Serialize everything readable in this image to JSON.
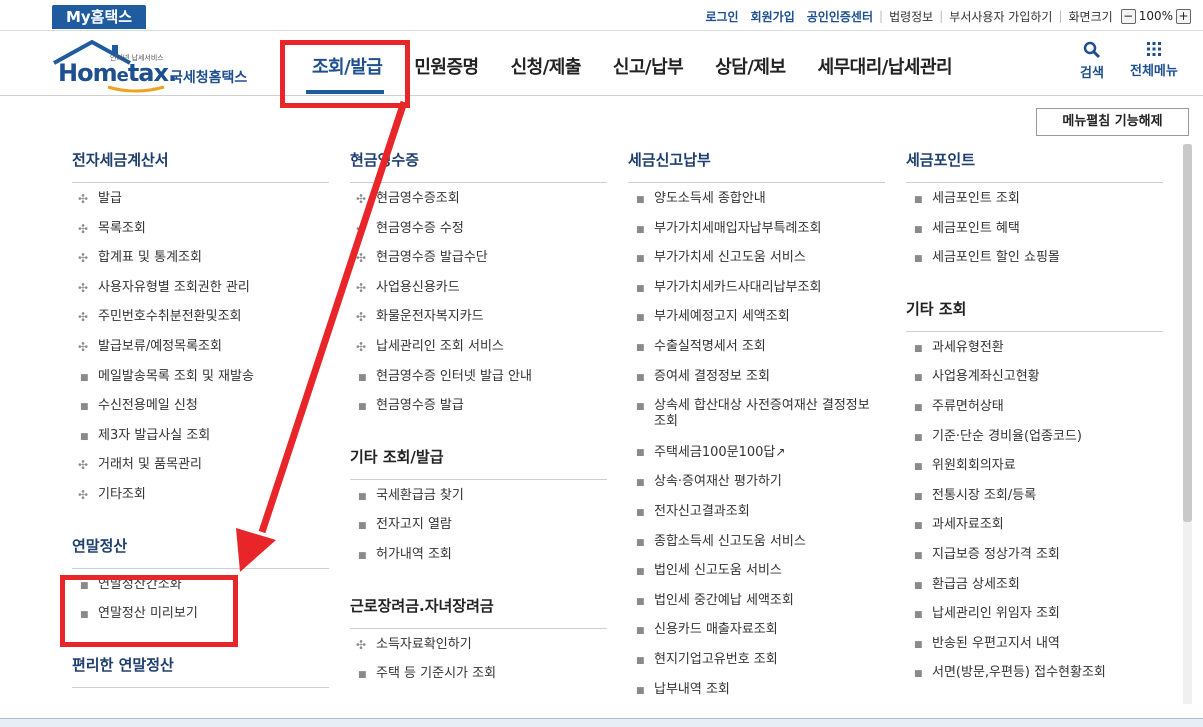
{
  "colors": {
    "brand": "#1e5b9f",
    "title": "#1e3e6e",
    "annotation": "#e8262a"
  },
  "utilbar": {
    "my_tab": "My홈택스",
    "links": [
      "로그인",
      "회원가입",
      "공인인증센터",
      "법령정보",
      "부서사용자 가입하기",
      "화면크기"
    ],
    "zoom_minus": "−",
    "zoom_value": "100%",
    "zoom_plus": "+"
  },
  "header": {
    "logo_main": "Hom",
    "logo_e": "e",
    "logo_end": "tax.",
    "logo_sub": "국세청홈택스",
    "logo_tiny": "인터넷 납세서비스",
    "menus": [
      "조회/발급",
      "민원증명",
      "신청/제출",
      "신고/납부",
      "상담/제보",
      "세무대리/납세관리"
    ],
    "search_label": "검색",
    "allmenu_label": "전체메뉴",
    "fold_button": "메뉴펼침 기능해제"
  },
  "columns": [
    {
      "sections": [
        {
          "title": "전자세금계산서",
          "style": "blue",
          "items": [
            {
              "b": "plus",
              "t": "발급"
            },
            {
              "b": "plus",
              "t": "목록조회"
            },
            {
              "b": "plus",
              "t": "합계표 및 통계조회"
            },
            {
              "b": "plus",
              "t": "사용자유형별 조회권한 관리"
            },
            {
              "b": "plus",
              "t": "주민번호수취분전환및조회"
            },
            {
              "b": "plus",
              "t": "발급보류/예정목록조회"
            },
            {
              "b": "dot",
              "t": "메일발송목록 조회 및 재발송"
            },
            {
              "b": "dot",
              "t": "수신전용메일 신청"
            },
            {
              "b": "dot",
              "t": "제3자 발급사실 조회"
            },
            {
              "b": "plus",
              "t": "거래처 및 품목관리"
            },
            {
              "b": "plus",
              "t": "기타조회"
            }
          ]
        },
        {
          "title": "연말정산",
          "style": "blue",
          "items": [
            {
              "b": "dot",
              "t": "연말정산간소화"
            },
            {
              "b": "dot",
              "t": "연말정산 미리보기"
            }
          ]
        },
        {
          "title": "편리한 연말정산",
          "style": "blue",
          "items": []
        }
      ]
    },
    {
      "sections": [
        {
          "title": "현금영수증",
          "style": "blue",
          "items": [
            {
              "b": "plus",
              "t": "현금영수증조회"
            },
            {
              "b": "plus",
              "t": "현금영수증 수정"
            },
            {
              "b": "plus",
              "t": "현금영수증 발급수단"
            },
            {
              "b": "plus",
              "t": "사업용신용카드"
            },
            {
              "b": "plus",
              "t": "화물운전자복지카드"
            },
            {
              "b": "plus",
              "t": "납세관리인 조회 서비스"
            },
            {
              "b": "dot",
              "t": "현금영수증 인터넷 발급 안내"
            },
            {
              "b": "dot",
              "t": "현금영수증 발급"
            }
          ]
        },
        {
          "title": "기타 조회/발급",
          "style": "plain",
          "items": [
            {
              "b": "dot",
              "t": "국세환급금 찾기"
            },
            {
              "b": "dot",
              "t": "전자고지 열람"
            },
            {
              "b": "dot",
              "t": "허가내역 조회"
            }
          ]
        },
        {
          "title": "근로장려금.자녀장려금",
          "style": "plain",
          "items": [
            {
              "b": "plus",
              "t": "소득자료확인하기"
            },
            {
              "b": "dot",
              "t": "주택 등 기준시가 조회"
            }
          ]
        }
      ]
    },
    {
      "sections": [
        {
          "title": "세금신고납부",
          "style": "blue",
          "items": [
            {
              "b": "dot",
              "t": "양도소득세 종합안내"
            },
            {
              "b": "dot",
              "t": "부가가치세매입자납부특례조회"
            },
            {
              "b": "dot",
              "t": "부가가치세 신고도움 서비스"
            },
            {
              "b": "dot",
              "t": "부가가치세카드사대리납부조회"
            },
            {
              "b": "dot",
              "t": "부가세예정고지 세액조회"
            },
            {
              "b": "dot",
              "t": "수출실적명세서 조회"
            },
            {
              "b": "dot",
              "t": "증여세 결정정보 조회"
            },
            {
              "b": "dot",
              "t": "상속세 합산대상 사전증여재산 결정정보 조회"
            },
            {
              "b": "dot",
              "t": "주택세금100문100답",
              "ext": "↗"
            },
            {
              "b": "dot",
              "t": "상속·증여재산 평가하기"
            },
            {
              "b": "dot",
              "t": "전자신고결과조회"
            },
            {
              "b": "dot",
              "t": "종합소득세 신고도움 서비스"
            },
            {
              "b": "dot",
              "t": "법인세 신고도움 서비스"
            },
            {
              "b": "dot",
              "t": "법인세 중간예납 세액조회"
            },
            {
              "b": "dot",
              "t": "신용카드 매출자료조회"
            },
            {
              "b": "dot",
              "t": "현지기업고유번호 조회"
            },
            {
              "b": "dot",
              "t": "납부내역 조회"
            }
          ]
        }
      ]
    },
    {
      "sections": [
        {
          "title": "세금포인트",
          "style": "blue",
          "items": [
            {
              "b": "dot",
              "t": "세금포인트 조회"
            },
            {
              "b": "dot",
              "t": "세금포인트 혜택"
            },
            {
              "b": "dot",
              "t": "세금포인트 할인 쇼핑몰"
            }
          ]
        },
        {
          "title": "기타 조회",
          "style": "plain",
          "items": [
            {
              "b": "dot",
              "t": "과세유형전환"
            },
            {
              "b": "dot",
              "t": "사업용계좌신고현황"
            },
            {
              "b": "dot",
              "t": "주류면허상태"
            },
            {
              "b": "dot",
              "t": "기준·단순 경비율(업종코드)"
            },
            {
              "b": "dot",
              "t": "위원회회의자료"
            },
            {
              "b": "dot",
              "t": "전통시장 조회/등록"
            },
            {
              "b": "dot",
              "t": "과세자료조회"
            },
            {
              "b": "dot",
              "t": "지급보증 정상가격 조회"
            },
            {
              "b": "dot",
              "t": "환급금 상세조회"
            },
            {
              "b": "dot",
              "t": "납세관리인 위임자 조회"
            },
            {
              "b": "dot",
              "t": "반송된 우편고지서 내역"
            },
            {
              "b": "dot",
              "t": "서면(방문,우편등) 접수현황조회"
            }
          ]
        }
      ]
    }
  ]
}
